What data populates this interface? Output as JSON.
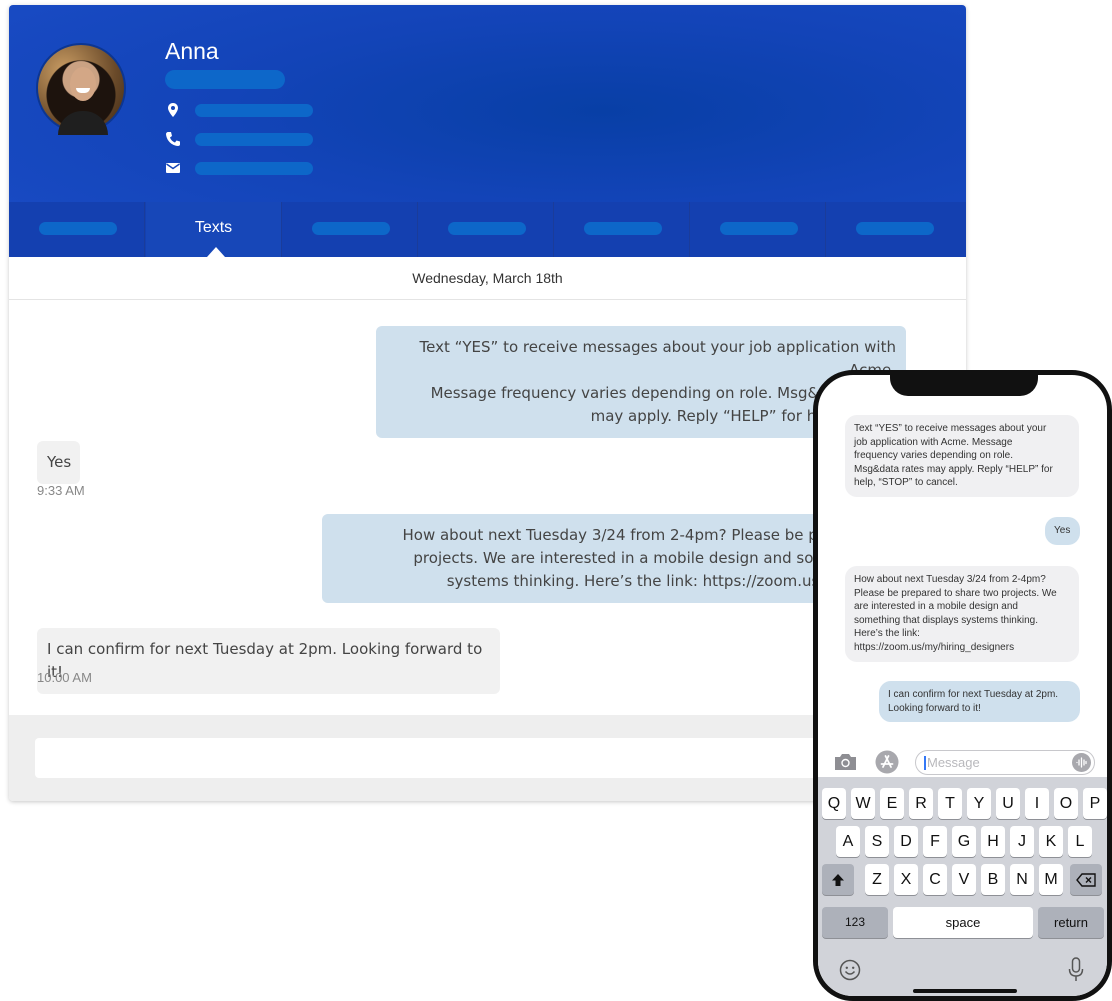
{
  "profile": {
    "name": "Anna",
    "icons": [
      "location-pin-icon",
      "phone-icon",
      "mail-icon"
    ]
  },
  "tabs": {
    "active_label": "Texts"
  },
  "thread": {
    "date": "Wednesday, March 18th",
    "messages": [
      {
        "dir": "out",
        "lines": [
          "Text “YES” to receive messages about your job application with Acme.",
          "Message frequency varies depending on role. Msg&data rates",
          "may apply. Reply “HELP” for help, “STOP"
        ]
      },
      {
        "dir": "in",
        "lines": [
          "Yes"
        ],
        "time": "9:33 AM"
      },
      {
        "dir": "out",
        "lines": [
          "How about next Tuesday 3/24 from 2-4pm? Please be prepared to",
          "projects. We are interested in a mobile design and something th",
          "systems thinking. Here’s the link: https://zoom.us/my/hiring"
        ]
      },
      {
        "dir": "in",
        "lines": [
          "I can confirm for next Tuesday at 2pm. Looking forward to it!"
        ],
        "time": "10:00 AM"
      }
    ]
  },
  "phone": {
    "messages": [
      {
        "dir": "in",
        "lines": [
          "Text “YES” to receive messages about your",
          "job application with Acme.  Message",
          "frequency varies depending on role.",
          "Msg&data rates may apply. Reply “HELP” for",
          "help, “STOP” to cancel."
        ]
      },
      {
        "dir": "out",
        "lines": [
          "Yes"
        ]
      },
      {
        "dir": "in",
        "lines": [
          "How about next Tuesday 3/24 from 2-4pm?",
          "Please be prepared to share two projects. We",
          "are interested in a mobile design and",
          "something that displays systems thinking.",
          "Here’s the link:",
          "https://zoom.us/my/hiring_designers"
        ]
      },
      {
        "dir": "out",
        "lines": [
          "I can confirm for next Tuesday at 2pm.",
          "Looking forward to it!"
        ]
      }
    ],
    "placeholder": "Message",
    "keyboard": {
      "row1": [
        "Q",
        "W",
        "E",
        "R",
        "T",
        "Y",
        "U",
        "I",
        "O",
        "P"
      ],
      "row2": [
        "A",
        "S",
        "D",
        "F",
        "G",
        "H",
        "J",
        "K",
        "L"
      ],
      "row3": [
        "Z",
        "X",
        "C",
        "V",
        "B",
        "N",
        "M"
      ],
      "numbers_key": "123",
      "space_key": "space",
      "return_key": "return"
    }
  }
}
